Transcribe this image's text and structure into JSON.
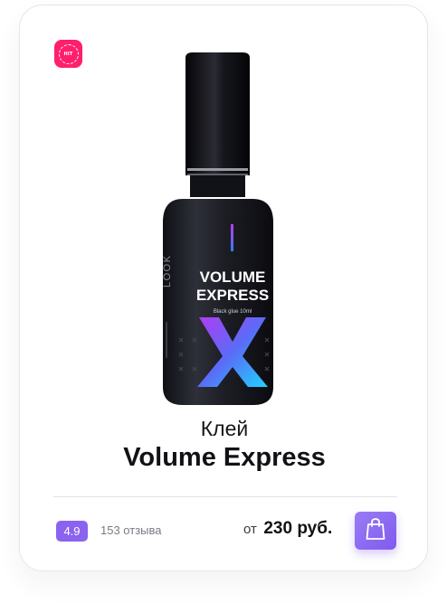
{
  "card": {
    "badge": "HIT",
    "image": {
      "brand_vertical": "LOOK",
      "label_line1": "VOLUME",
      "label_line2": "EXPRESS",
      "label_sub": "Black glue 10ml",
      "big_letter": "X"
    },
    "category": "Клей",
    "product_name": "Volume Express",
    "rating": "4.9",
    "reviews": "153 отзыва",
    "price_prefix": "от",
    "price_value": "230 руб.",
    "cart_icon": "shopping-bag-icon"
  },
  "colors": {
    "badge": "#ff1f6d",
    "accent": "#8a63f0",
    "text": "#121216",
    "muted": "#7b7b85"
  }
}
